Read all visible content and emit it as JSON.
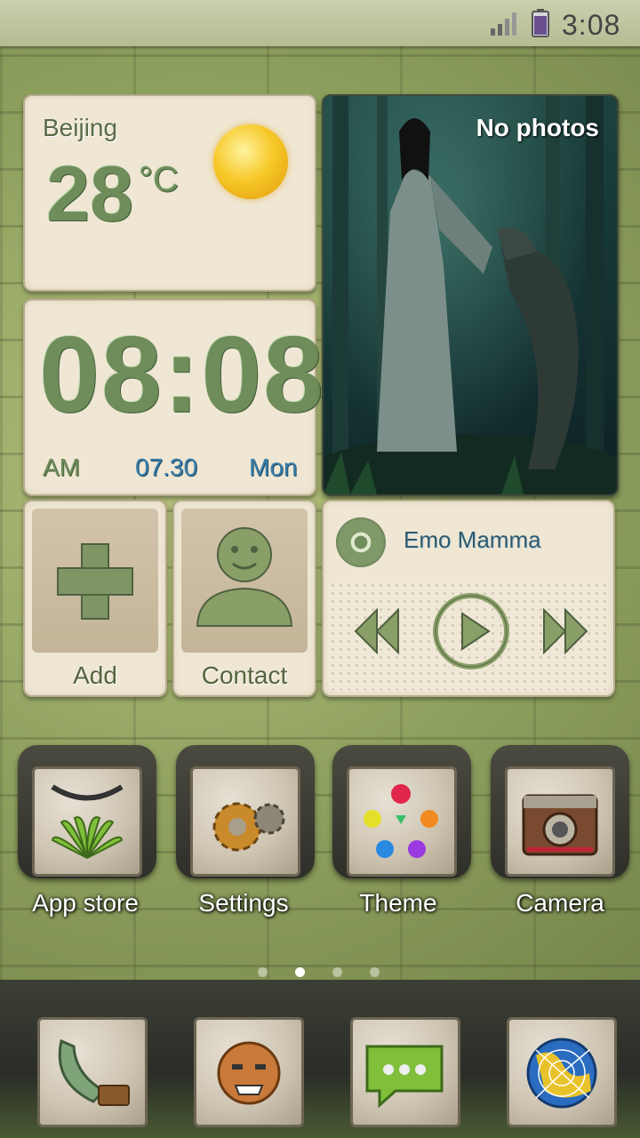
{
  "status_bar": {
    "time": "3:08",
    "battery_icon": "battery-icon",
    "signal_icon": "signal-icon"
  },
  "weather": {
    "city": "Beijing",
    "temperature": "28",
    "unit": "°C",
    "icon": "sun-icon"
  },
  "clock": {
    "time": "08:08",
    "ampm": "AM",
    "date": "07.30",
    "day": "Mon"
  },
  "photo_widget": {
    "label": "No photos"
  },
  "shortcut_tiles": [
    {
      "label": "Add",
      "icon": "plus-icon"
    },
    {
      "label": "Contact",
      "icon": "person-icon"
    }
  ],
  "music": {
    "title": "Emo Mamma",
    "controls": [
      "rewind-icon",
      "play-icon",
      "fast-forward-icon"
    ]
  },
  "apps": [
    {
      "label": "App store",
      "icon": "huawei-logo-icon"
    },
    {
      "label": "Settings",
      "icon": "gears-icon"
    },
    {
      "label": "Theme",
      "icon": "gems-icon"
    },
    {
      "label": "Camera",
      "icon": "camera-icon"
    }
  ],
  "page_indicator": {
    "count": 4,
    "active": 2
  },
  "dock": [
    {
      "icon": "phone-icon"
    },
    {
      "icon": "mask-icon"
    },
    {
      "icon": "chat-icon"
    },
    {
      "icon": "globe-icon"
    }
  ],
  "colors": {
    "accent_blue": "#3b7da6",
    "stone_green": "#6f8d5a",
    "card_bg": "#efe7d4"
  }
}
